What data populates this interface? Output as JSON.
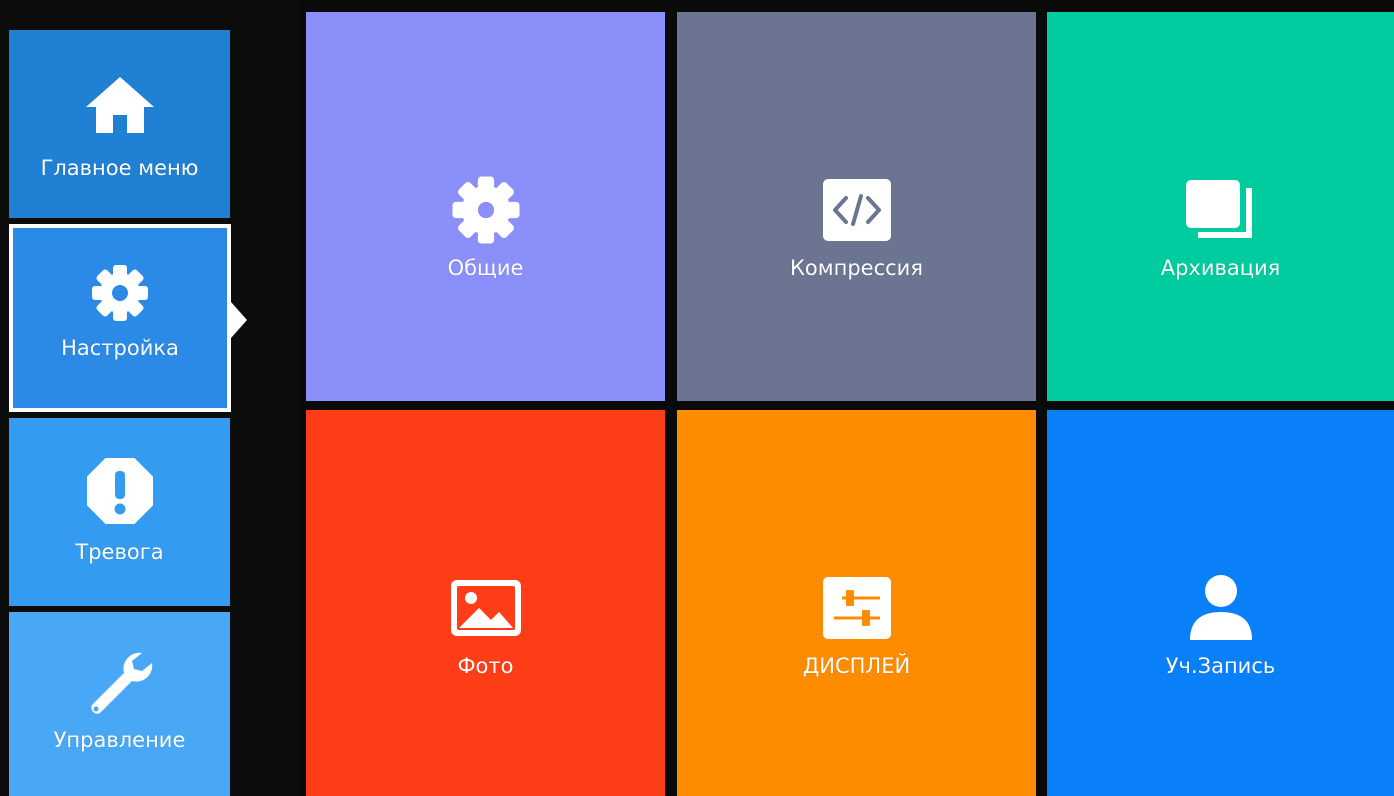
{
  "sidebar": {
    "items": [
      {
        "label": "Главное меню",
        "icon": "home-icon",
        "color": "#2080d4"
      },
      {
        "label": "Настройка",
        "icon": "gear-icon",
        "color": "#2a8ae6",
        "selected": true
      },
      {
        "label": "Тревога",
        "icon": "alarm-icon",
        "color": "#349cf0"
      },
      {
        "label": "Управление",
        "icon": "wrench-icon",
        "color": "#48a8f6"
      }
    ]
  },
  "tiles": [
    {
      "label": "Общие",
      "icon": "gear-icon",
      "color": "#8b8ffa"
    },
    {
      "label": "Компрессия",
      "icon": "code-icon",
      "color": "#6b7592"
    },
    {
      "label": "Архивация",
      "icon": "copy-icon",
      "color": "#00cc9f"
    },
    {
      "label": "Фото",
      "icon": "image-icon",
      "color": "#ff3d17"
    },
    {
      "label": "ДИСПЛЕЙ",
      "icon": "sliders-icon",
      "color": "#ff8c00"
    },
    {
      "label": "Уч.Запись",
      "icon": "user-icon",
      "color": "#0a80f8"
    }
  ]
}
